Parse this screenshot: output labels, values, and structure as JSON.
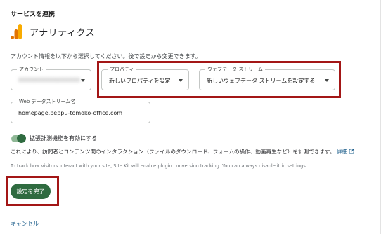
{
  "section": {
    "title": "サービスを連携"
  },
  "service": {
    "name": "アナリティクス",
    "logo_icon": "google-analytics-bars-icon",
    "logo_colors": [
      "#f9ab00",
      "#e37400"
    ]
  },
  "intro_text": "アカウント情報を以下から選択してください。後で設定から変更できます。",
  "fields": {
    "account": {
      "label": "アカウント",
      "value": "XXXXXXXXXXXXXXXX"
    },
    "property": {
      "label": "プロパティ",
      "value": "新しいプロパティを設定"
    },
    "web_stream": {
      "label": "ウェブデータ ストリーム",
      "value": "新しいウェブデータ ストリームを設定する"
    },
    "web_stream_name": {
      "label": "Web データストリーム名",
      "value": "homepage.beppu-tomoko-office.com"
    }
  },
  "enhanced_measurement": {
    "label": "拡張計測機能を有効にする",
    "enabled": true,
    "description": "これにより、訪問者とコンテンツ間のインタラクション（ファイルのダウンロード、フォームの操作、動画再生など）を計測できます。",
    "learn_more": "詳細"
  },
  "note": "To track how visitors interact with your site, Site Kit will enable plugin conversion tracking. You can always disable it in settings.",
  "buttons": {
    "complete": "設定を完了",
    "cancel": "キャンセル"
  },
  "colors": {
    "accent_green": "#2f6b40",
    "highlight_red": "#a31616",
    "link_blue": "#1a5c8a"
  }
}
